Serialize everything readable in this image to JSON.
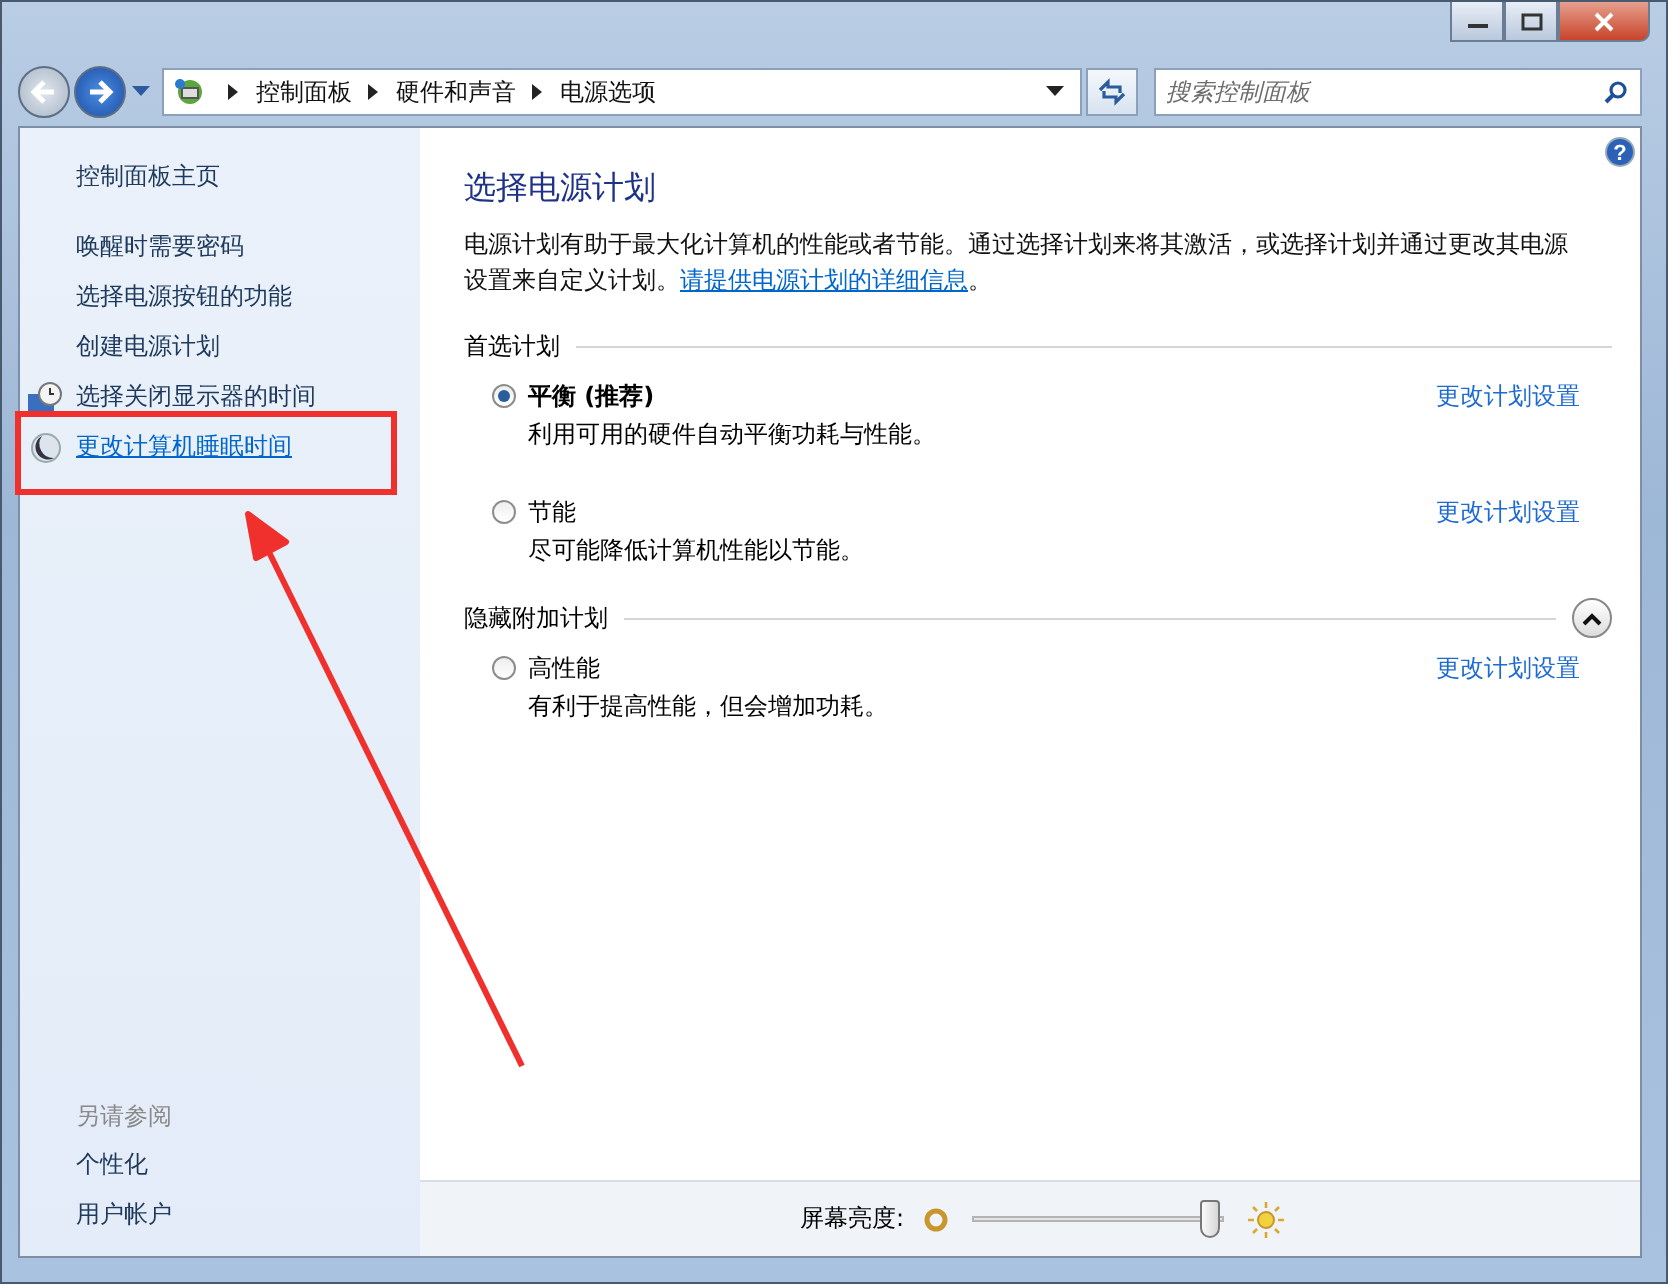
{
  "nav": {
    "breadcrumb": [
      "控制面板",
      "硬件和声音",
      "电源选项"
    ],
    "search": {
      "placeholder": "搜索控制面板"
    }
  },
  "sidebar": {
    "home": "控制面板主页",
    "tasks": [
      {
        "label": "唤醒时需要密码",
        "kind": "text",
        "hovered": false
      },
      {
        "label": "选择电源按钮的功能",
        "kind": "text",
        "hovered": false
      },
      {
        "label": "创建电源计划",
        "kind": "text",
        "hovered": false
      },
      {
        "label": "选择关闭显示器的时间",
        "kind": "clock",
        "hovered": false
      },
      {
        "label": "更改计算机睡眠时间",
        "kind": "moon",
        "hovered": true
      }
    ],
    "see_also": {
      "heading": "另请参阅",
      "items": [
        "个性化",
        "用户帐户"
      ]
    }
  },
  "main": {
    "help": "?",
    "title": "选择电源计划",
    "description": {
      "text": "电源计划有助于最大化计算机的性能或者节能。通过选择计划来将其激活，或选择计划并通过更改其电源设置来自定义计划。",
      "link": "请提供电源计划的详细信息",
      "after": "。"
    },
    "groups": [
      {
        "heading": "首选计划",
        "collapsible": false,
        "plans": [
          {
            "name": "平衡 (推荐)",
            "description": "利用可用的硬件自动平衡功耗与性能。",
            "selected": true,
            "action": "更改计划设置"
          },
          {
            "name": "节能",
            "description": "尽可能降低计算机性能以节能。",
            "selected": false,
            "action": "更改计划设置"
          }
        ]
      },
      {
        "heading": "隐藏附加计划",
        "collapsible": true,
        "plans": [
          {
            "name": "高性能",
            "description": "有利于提高性能，但会增加功耗。",
            "selected": false,
            "action": "更改计划设置"
          }
        ]
      }
    ]
  },
  "brightness": {
    "label": "屏幕亮度:",
    "level": 0.97
  },
  "annotation": {
    "kind": "box-and-arrow"
  }
}
